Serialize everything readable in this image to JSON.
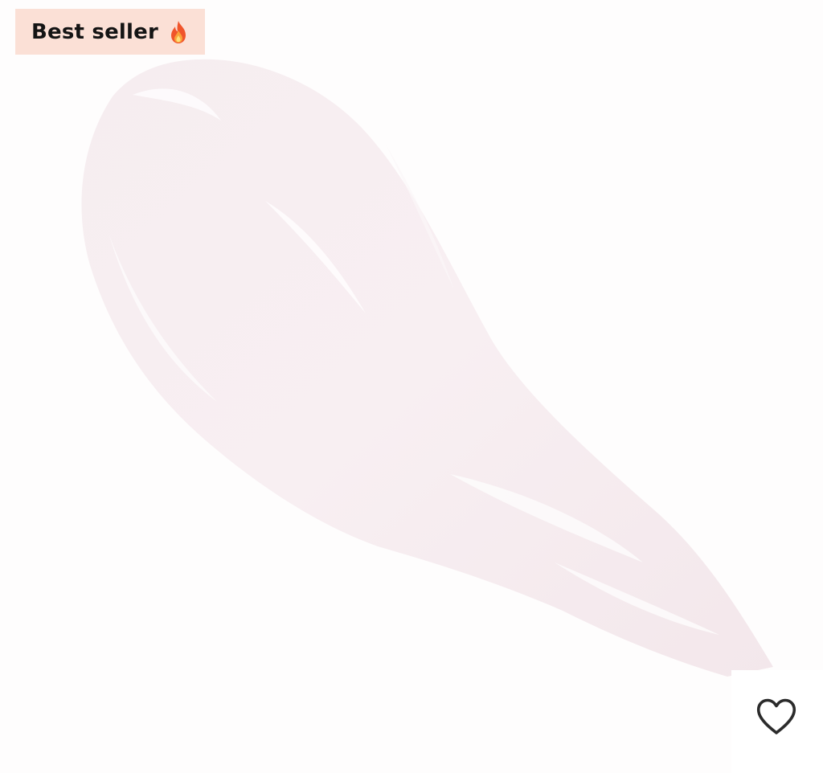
{
  "badge": {
    "label": "Best seller",
    "emoji_icon": "fire-icon",
    "background_color": "#fbe0d6"
  },
  "product_image": {
    "swatch_color": "#f7eef1"
  },
  "wishlist": {
    "icon": "heart-outline-icon"
  }
}
